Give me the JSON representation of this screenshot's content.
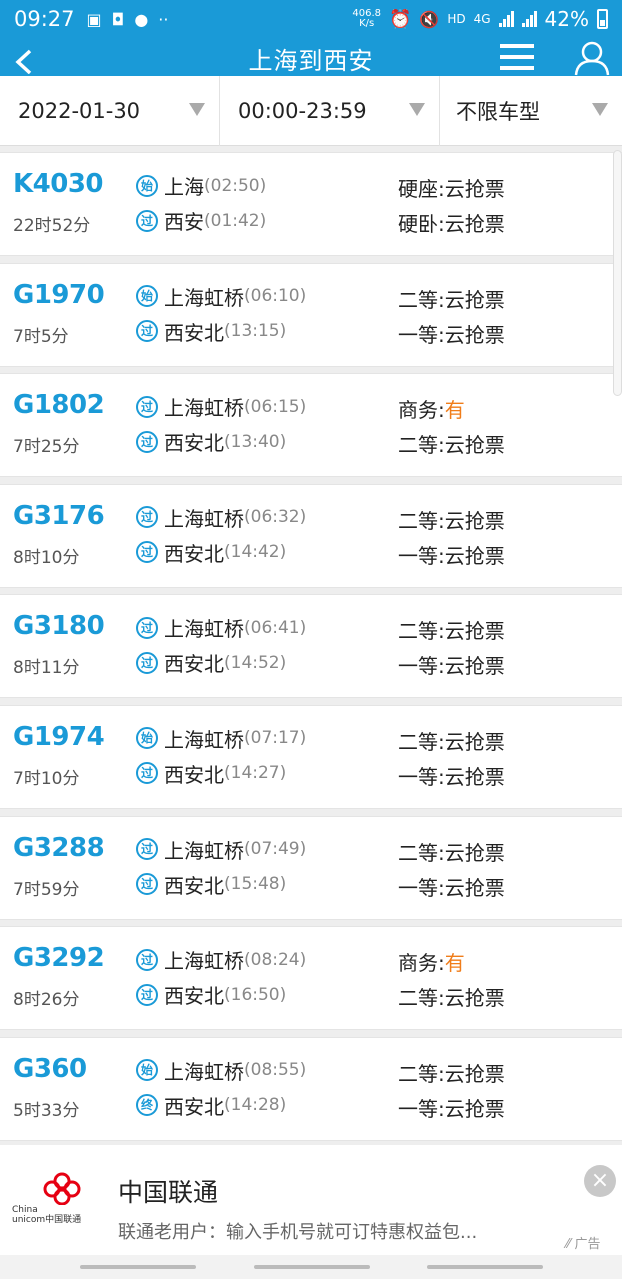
{
  "status_bar": {
    "time": "09:27",
    "net_speed_value": "406.8",
    "net_speed_unit": "K/s",
    "network": "4G",
    "hd": "HD",
    "battery": "42%"
  },
  "nav": {
    "title": "上海到西安"
  },
  "filters": {
    "date": "2022-01-30",
    "time_range": "00:00-23:59",
    "train_type": "不限车型"
  },
  "trains": [
    {
      "no": "K4030",
      "duration": "22时52分",
      "from_badge": "始",
      "from_station": "上海",
      "from_time": "(02:50)",
      "to_badge": "过",
      "to_station": "西安",
      "to_time": "(01:42)",
      "seat1_label": "硬座:",
      "seat1_status": "云抢票",
      "seat2_label": "硬卧:",
      "seat2_status": "云抢票"
    },
    {
      "no": "G1970",
      "duration": "7时5分",
      "from_badge": "始",
      "from_station": "上海虹桥",
      "from_time": "(06:10)",
      "to_badge": "过",
      "to_station": "西安北",
      "to_time": "(13:15)",
      "seat1_label": "二等:",
      "seat1_status": "云抢票",
      "seat2_label": "一等:",
      "seat2_status": "云抢票"
    },
    {
      "no": "G1802",
      "duration": "7时25分",
      "from_badge": "过",
      "from_station": "上海虹桥",
      "from_time": "(06:15)",
      "to_badge": "过",
      "to_station": "西安北",
      "to_time": "(13:40)",
      "seat1_label": "商务:",
      "seat1_status": "有",
      "seat2_label": "二等:",
      "seat2_status": "云抢票"
    },
    {
      "no": "G3176",
      "duration": "8时10分",
      "from_badge": "过",
      "from_station": "上海虹桥",
      "from_time": "(06:32)",
      "to_badge": "过",
      "to_station": "西安北",
      "to_time": "(14:42)",
      "seat1_label": "二等:",
      "seat1_status": "云抢票",
      "seat2_label": "一等:",
      "seat2_status": "云抢票"
    },
    {
      "no": "G3180",
      "duration": "8时11分",
      "from_badge": "过",
      "from_station": "上海虹桥",
      "from_time": "(06:41)",
      "to_badge": "过",
      "to_station": "西安北",
      "to_time": "(14:52)",
      "seat1_label": "二等:",
      "seat1_status": "云抢票",
      "seat2_label": "一等:",
      "seat2_status": "云抢票"
    },
    {
      "no": "G1974",
      "duration": "7时10分",
      "from_badge": "始",
      "from_station": "上海虹桥",
      "from_time": "(07:17)",
      "to_badge": "过",
      "to_station": "西安北",
      "to_time": "(14:27)",
      "seat1_label": "二等:",
      "seat1_status": "云抢票",
      "seat2_label": "一等:",
      "seat2_status": "云抢票"
    },
    {
      "no": "G3288",
      "duration": "7时59分",
      "from_badge": "过",
      "from_station": "上海虹桥",
      "from_time": "(07:49)",
      "to_badge": "过",
      "to_station": "西安北",
      "to_time": "(15:48)",
      "seat1_label": "二等:",
      "seat1_status": "云抢票",
      "seat2_label": "一等:",
      "seat2_status": "云抢票"
    },
    {
      "no": "G3292",
      "duration": "8时26分",
      "from_badge": "过",
      "from_station": "上海虹桥",
      "from_time": "(08:24)",
      "to_badge": "过",
      "to_station": "西安北",
      "to_time": "(16:50)",
      "seat1_label": "商务:",
      "seat1_status": "有",
      "seat2_label": "二等:",
      "seat2_status": "云抢票"
    },
    {
      "no": "G360",
      "duration": "5时33分",
      "from_badge": "始",
      "from_station": "上海虹桥",
      "from_time": "(08:55)",
      "to_badge": "终",
      "to_station": "西安北",
      "to_time": "(14:28)",
      "seat1_label": "二等:",
      "seat1_status": "云抢票",
      "seat2_label": "一等:",
      "seat2_status": "云抢票"
    }
  ],
  "ad": {
    "logo_text_line1": "China",
    "logo_text_line2": "unicom中国联通",
    "title": "中国联通",
    "description": "联通老用户：输入手机号就可订特惠权益包...",
    "tag": "广告",
    "close_symbol": "×"
  },
  "colors": {
    "brand": "#1a9ad7",
    "available": "#f07d1a"
  }
}
